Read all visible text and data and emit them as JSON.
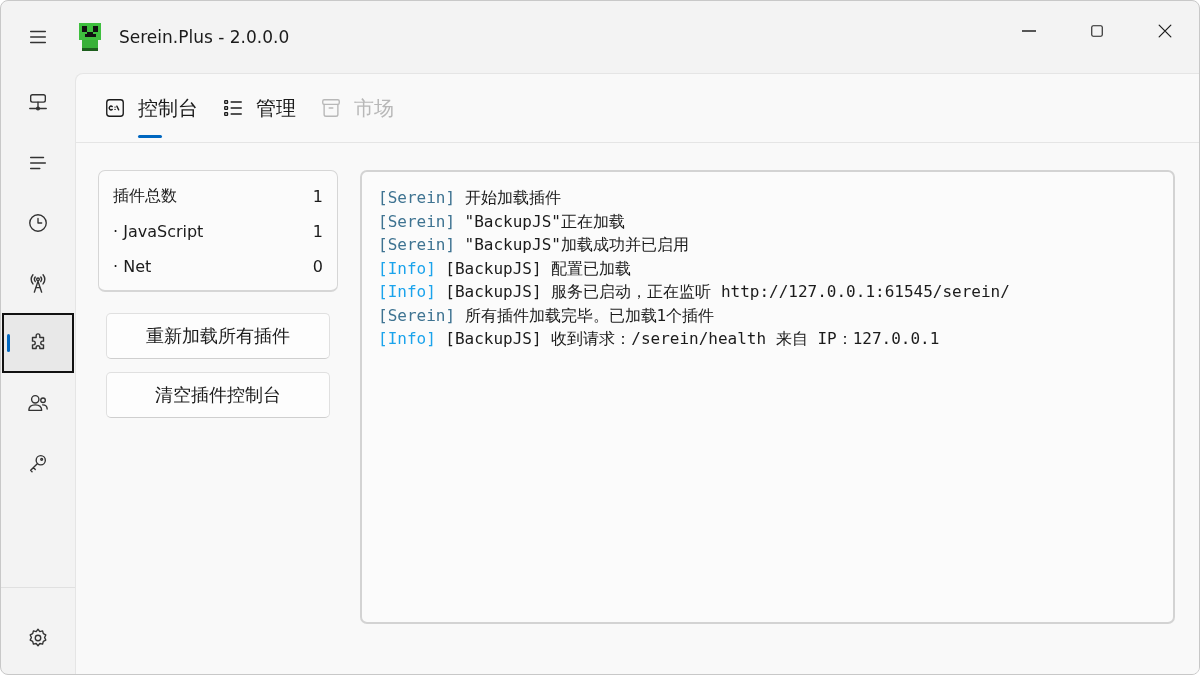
{
  "window": {
    "title": "Serein.Plus - 2.0.0.0"
  },
  "nav_items": [
    {
      "kind": "network",
      "selected": false,
      "focused": false
    },
    {
      "kind": "list",
      "selected": false,
      "focused": false
    },
    {
      "kind": "clock",
      "selected": false,
      "focused": false
    },
    {
      "kind": "antenna",
      "selected": false,
      "focused": false
    },
    {
      "kind": "puzzle",
      "selected": true,
      "focused": true
    },
    {
      "kind": "people",
      "selected": false,
      "focused": false
    },
    {
      "kind": "key",
      "selected": false,
      "focused": false
    }
  ],
  "nav_footer": [
    {
      "kind": "settings",
      "selected": false,
      "focused": false
    }
  ],
  "tabs": [
    {
      "kind": "console",
      "label": "控制台",
      "selected": true,
      "disabled": false
    },
    {
      "kind": "manage",
      "label": "管理",
      "selected": false,
      "disabled": false
    },
    {
      "kind": "market",
      "label": "市场",
      "selected": false,
      "disabled": true
    }
  ],
  "stats": [
    {
      "label": "插件总数",
      "value": "1"
    },
    {
      "label": "· JavaScript",
      "value": "1"
    },
    {
      "label": "· Net",
      "value": "0"
    }
  ],
  "buttons": [
    "重新加载所有插件",
    "清空插件控制台"
  ],
  "console": [
    {
      "kind": "serein",
      "tag": "[Serein]",
      "text": "开始加载插件"
    },
    {
      "kind": "serein",
      "tag": "[Serein]",
      "text": "\"BackupJS\"正在加载"
    },
    {
      "kind": "serein",
      "tag": "[Serein]",
      "text": "\"BackupJS\"加载成功并已启用"
    },
    {
      "kind": "info",
      "tag": "[Info]",
      "text": "[BackupJS] 配置已加载"
    },
    {
      "kind": "info",
      "tag": "[Info]",
      "text": "[BackupJS] 服务已启动，正在监听 http://127.0.0.1:61545/serein/"
    },
    {
      "kind": "serein",
      "tag": "[Serein]",
      "text": "所有插件加载完毕。已加载1个插件"
    },
    {
      "kind": "info",
      "tag": "[Info]",
      "text": "[BackupJS] 收到请求：/serein/health 来自 IP：127.0.0.1"
    }
  ]
}
